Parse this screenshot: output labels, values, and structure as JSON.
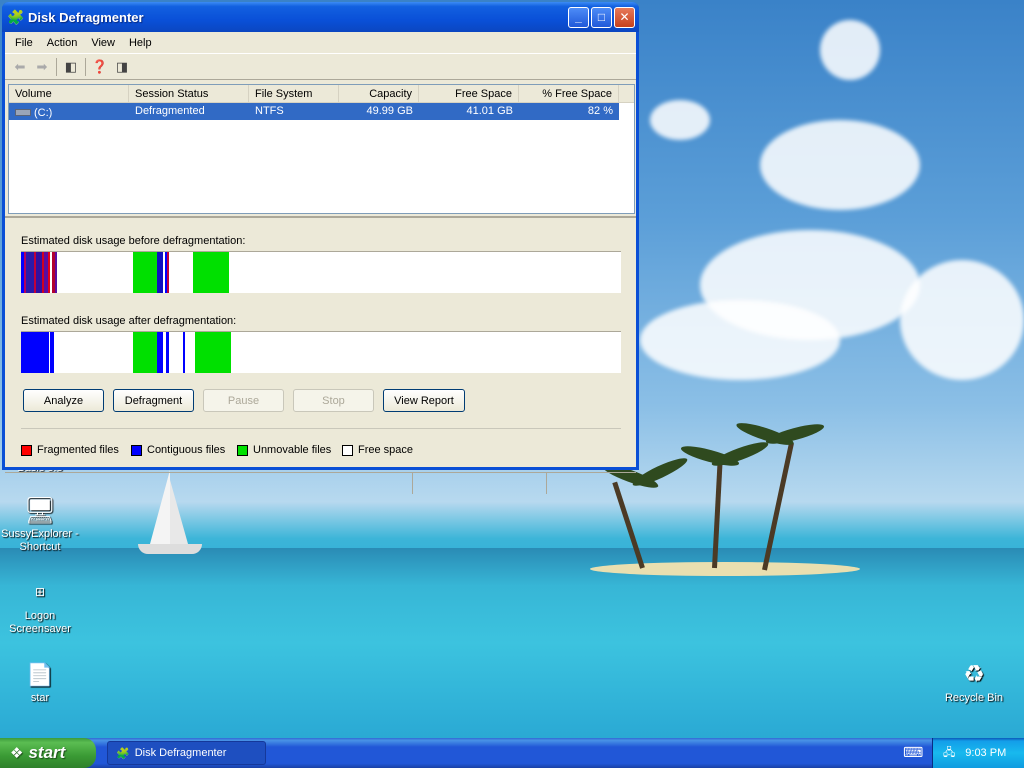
{
  "window": {
    "title": "Disk Defragmenter",
    "menu": [
      "File",
      "Action",
      "View",
      "Help"
    ]
  },
  "list": {
    "headers": [
      "Volume",
      "Session Status",
      "File System",
      "Capacity",
      "Free Space",
      "% Free Space"
    ],
    "rows": [
      {
        "volume": "(C:)",
        "status": "Defragmented",
        "fs": "NTFS",
        "capacity": "49.99 GB",
        "free": "41.01 GB",
        "pct": "82 %"
      }
    ]
  },
  "labels": {
    "before": "Estimated disk usage before defragmentation:",
    "after": "Estimated disk usage after defragmentation:"
  },
  "buttons": {
    "analyze": "Analyze",
    "defragment": "Defragment",
    "pause": "Pause",
    "stop": "Stop",
    "report": "View Report"
  },
  "legend": {
    "fragmented": "Fragmented files",
    "contiguous": "Contiguous files",
    "unmovable": "Unmovable files",
    "free": "Free space"
  },
  "colors": {
    "fragmented": "#ff0000",
    "contiguous": "#0000ff",
    "unmovable": "#00e000",
    "free": "#ffffff"
  },
  "desktop": {
    "icons": [
      "SussyExplorer - Shortcut",
      "Logon Screensaver",
      "star",
      "Recycle Bin"
    ],
    "partial_label": "Basic o.o"
  },
  "taskbar": {
    "start": "start",
    "task": "Disk Defragmenter",
    "clock": "9:03 PM"
  }
}
